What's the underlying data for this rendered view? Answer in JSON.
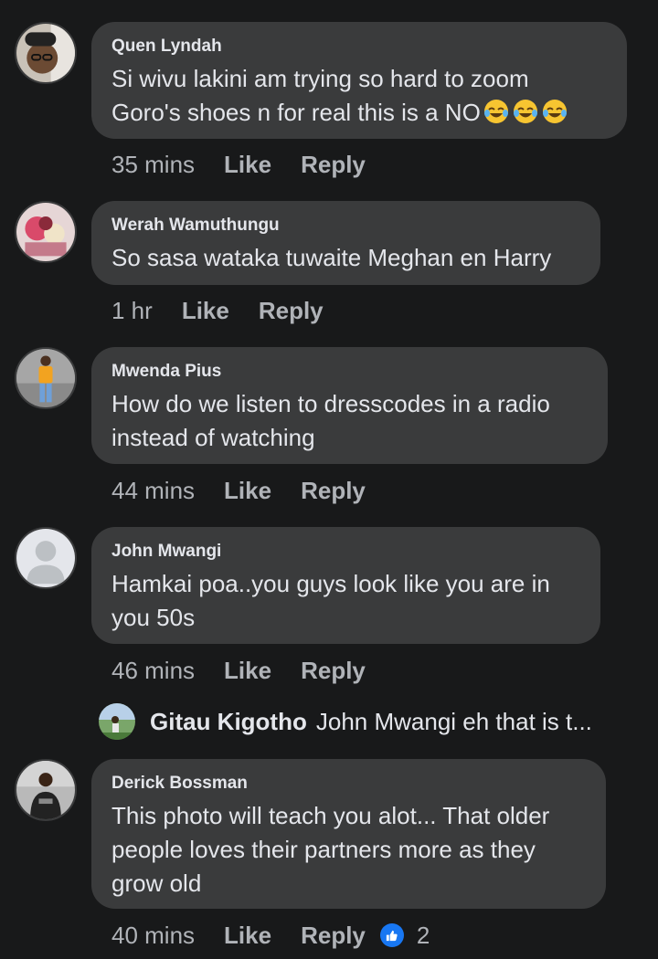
{
  "comments": [
    {
      "author": "Quen Lyndah",
      "text_line1": "Si wivu lakini am trying so hard to zoom",
      "text_line2": "Goro's shoes n for real this is a NO",
      "emoji": "rolling-on-floor-laughing",
      "time": "35 mins",
      "like": "Like",
      "reply": "Reply"
    },
    {
      "author": "Werah Wamuthungu",
      "text_line1": "So sasa wataka tuwaite Meghan en Harry",
      "time": "1 hr",
      "like": "Like",
      "reply": "Reply"
    },
    {
      "author": "Mwenda Pius",
      "text_line1": "How do we listen to dresscodes in a radio",
      "text_line2": "instead of watching",
      "time": "44 mins",
      "like": "Like",
      "reply": "Reply"
    },
    {
      "author": "John Mwangi",
      "text_line1": "Hamkai poa..you guys look like you are in",
      "text_line2": "you 50s",
      "time": "46 mins",
      "like": "Like",
      "reply": "Reply"
    },
    {
      "author": "Derick Bossman",
      "text_line1": "This photo will teach you alot... That older",
      "text_line2": "people loves their partners more as they",
      "text_line3": "grow old",
      "time": "40 mins",
      "like": "Like",
      "reply": "Reply",
      "reaction_count": "2"
    }
  ],
  "reply_preview": {
    "author": "Gitau Kigotho",
    "text": "John Mwangi eh that is t..."
  },
  "colors": {
    "background": "#18191a",
    "bubble": "#3a3b3c",
    "text": "#e4e6eb",
    "secondary": "#b0b3b8",
    "like_blue": "#1877f2"
  }
}
